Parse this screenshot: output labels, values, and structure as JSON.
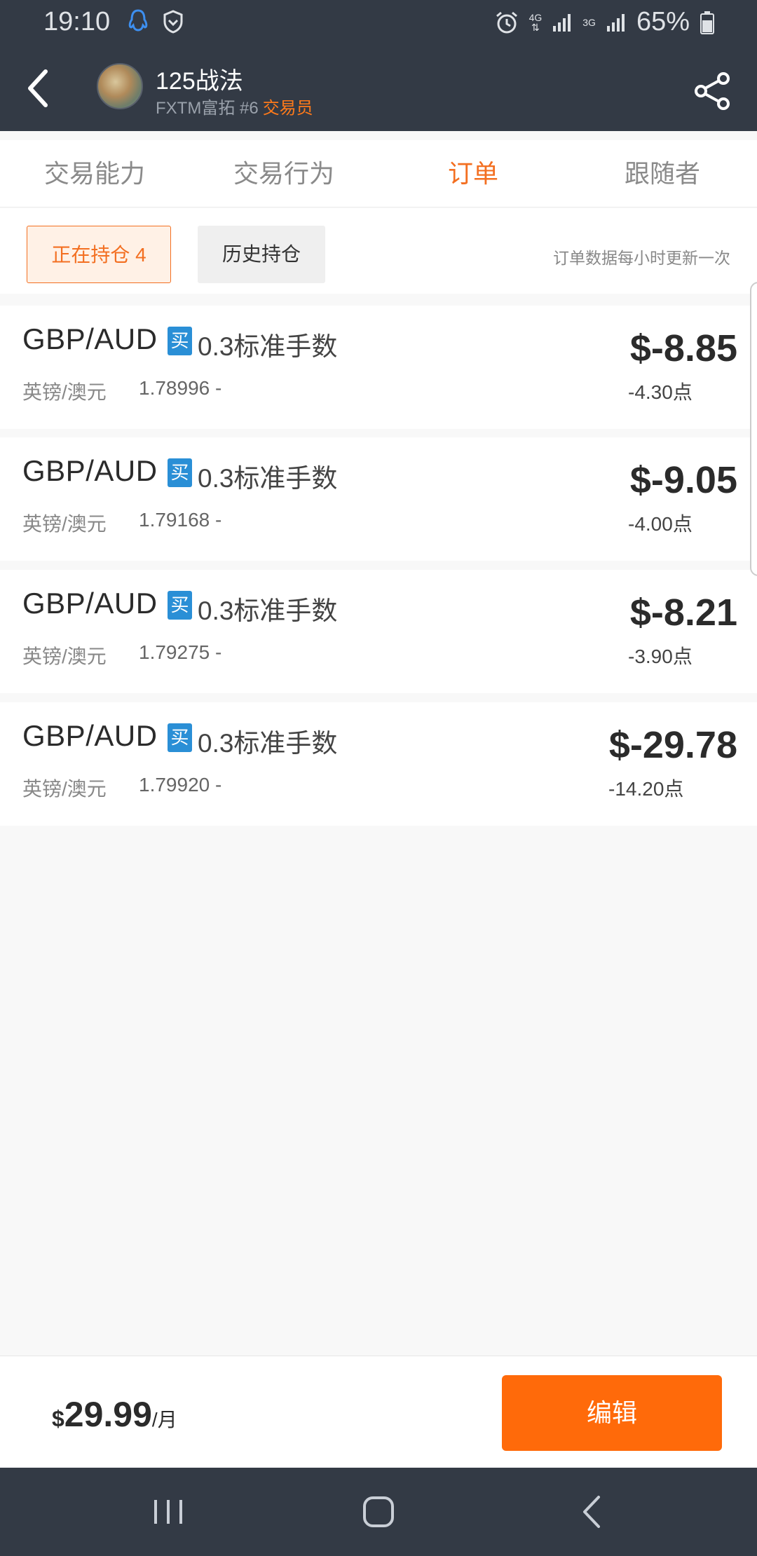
{
  "status_bar": {
    "time": "19:10",
    "network_top": "4G",
    "network_bottom": "3G",
    "battery": "65%"
  },
  "header": {
    "trader_name": "125战法",
    "broker": "FXTM富拓 #6",
    "role": "交易员"
  },
  "tabs": [
    {
      "label": "交易能力",
      "active": false
    },
    {
      "label": "交易行为",
      "active": false
    },
    {
      "label": "订单",
      "active": true
    },
    {
      "label": "跟随者",
      "active": false
    }
  ],
  "subbar": {
    "open_positions": "正在持仓 4",
    "history": "历史持仓",
    "update_note": "订单数据每小时更新一次"
  },
  "orders": [
    {
      "pair": "GBP/AUD",
      "side": "买",
      "lots": "0.3标准手数",
      "name": "英镑/澳元",
      "price": "1.78996 -",
      "profit": "$-8.85",
      "points": "-4.30点"
    },
    {
      "pair": "GBP/AUD",
      "side": "买",
      "lots": "0.3标准手数",
      "name": "英镑/澳元",
      "price": "1.79168 -",
      "profit": "$-9.05",
      "points": "-4.00点"
    },
    {
      "pair": "GBP/AUD",
      "side": "买",
      "lots": "0.3标准手数",
      "name": "英镑/澳元",
      "price": "1.79275 -",
      "profit": "$-8.21",
      "points": "-3.90点"
    },
    {
      "pair": "GBP/AUD",
      "side": "买",
      "lots": "0.3标准手数",
      "name": "英镑/澳元",
      "price": "1.79920 -",
      "profit": "$-29.78",
      "points": "-14.20点"
    }
  ],
  "bottom": {
    "currency": "$",
    "price": "29.99",
    "unit": "/月",
    "edit_label": "编辑"
  },
  "colors": {
    "header_bg": "#333a45",
    "accent": "#f36f21",
    "buy_badge": "#2a8fd6",
    "edit_button": "#ff6a0a"
  },
  "icons": {
    "back": "chevron-left-icon",
    "share": "share-icon",
    "nav_recents": "recents-icon",
    "nav_home": "home-icon",
    "nav_back": "back-icon"
  }
}
